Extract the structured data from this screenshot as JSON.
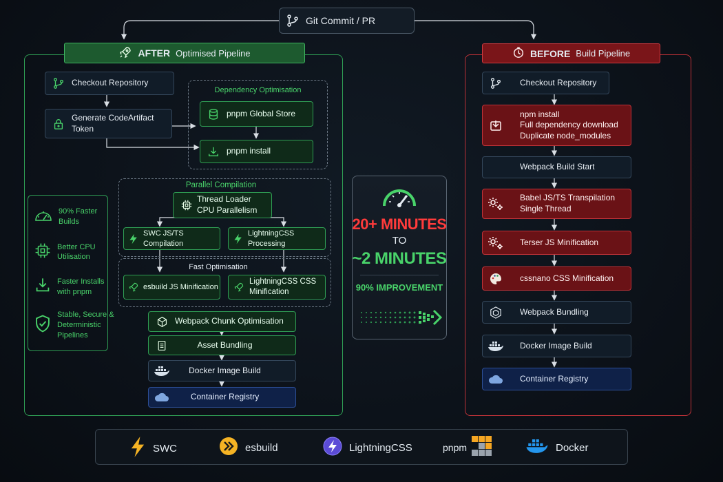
{
  "top": {
    "label": "Git Commit / PR",
    "icon": "git-branch-icon"
  },
  "after": {
    "banner_strong": "AFTER",
    "banner_rest": "Optimised Pipeline",
    "checkout": "Checkout Repository",
    "token_line1": "Generate CodeArtifact",
    "token_line2": "Token",
    "dependency_title": "Dependency Optimisation",
    "pnpm_store": "pnpm Global Store",
    "pnpm_install": "pnpm install",
    "parallel_title": "Parallel Compilation",
    "thread_line1": "Thread Loader",
    "thread_line2": "CPU Parallelism",
    "swc": "SWC JS/TS Compilation",
    "lightning_proc": "LightningCSS Processing",
    "fast_title": "Fast Optimisation",
    "esbuild_min": "esbuild JS Minification",
    "lightning_min_line1": "LightningCSS CSS",
    "lightning_min_line2": "Minification",
    "chunk": "Webpack Chunk Optimisation",
    "asset": "Asset Bundling",
    "docker": "Docker Image Build",
    "registry": "Container Registry"
  },
  "benefits": [
    {
      "line1": "90% Faster",
      "line2": "Builds",
      "icon": "speedometer-icon"
    },
    {
      "line1": "Better CPU",
      "line2": "Utilisation",
      "icon": "cpu-icon"
    },
    {
      "line1": "Faster Installs",
      "line2": "with pnpm",
      "icon": "download-icon"
    },
    {
      "line1": "Stable, Secure &",
      "line2": "Deterministic",
      "line3": "Pipelines",
      "icon": "shield-check-icon"
    }
  ],
  "stats": {
    "line1": "20+ MINUTES",
    "line2": "TO",
    "line3": "~2 MINUTES",
    "improvement": "90% IMPROVEMENT"
  },
  "before": {
    "banner_strong": "BEFORE",
    "banner_rest": "Build Pipeline",
    "checkout": "Checkout Repository",
    "npm_line1": "npm install",
    "npm_line2": "Full dependency download",
    "npm_line3": "Duplicate node_modules",
    "webpack_start": "Webpack Build Start",
    "babel_line1": "Babel JS/TS Transpilation",
    "babel_line2": "Single Thread",
    "terser": "Terser JS Minification",
    "cssnano": "cssnano CSS Minification",
    "bundling": "Webpack Bundling",
    "docker": "Docker Image Build",
    "registry": "Container Registry"
  },
  "legend": [
    {
      "label": "SWC",
      "icon": "swc-bolt-icon"
    },
    {
      "label": "esbuild",
      "icon": "esbuild-icon"
    },
    {
      "label": "LightningCSS",
      "icon": "lightningcss-icon"
    },
    {
      "label": "pnpm",
      "icon": "pnpm-icon"
    },
    {
      "label": "Docker",
      "icon": "docker-icon"
    }
  ],
  "colors": {
    "green": "#2f9e54",
    "green_text": "#49d36a",
    "red": "#c03238",
    "red_text": "#ff3b3b",
    "blue": "#2d4f97"
  }
}
